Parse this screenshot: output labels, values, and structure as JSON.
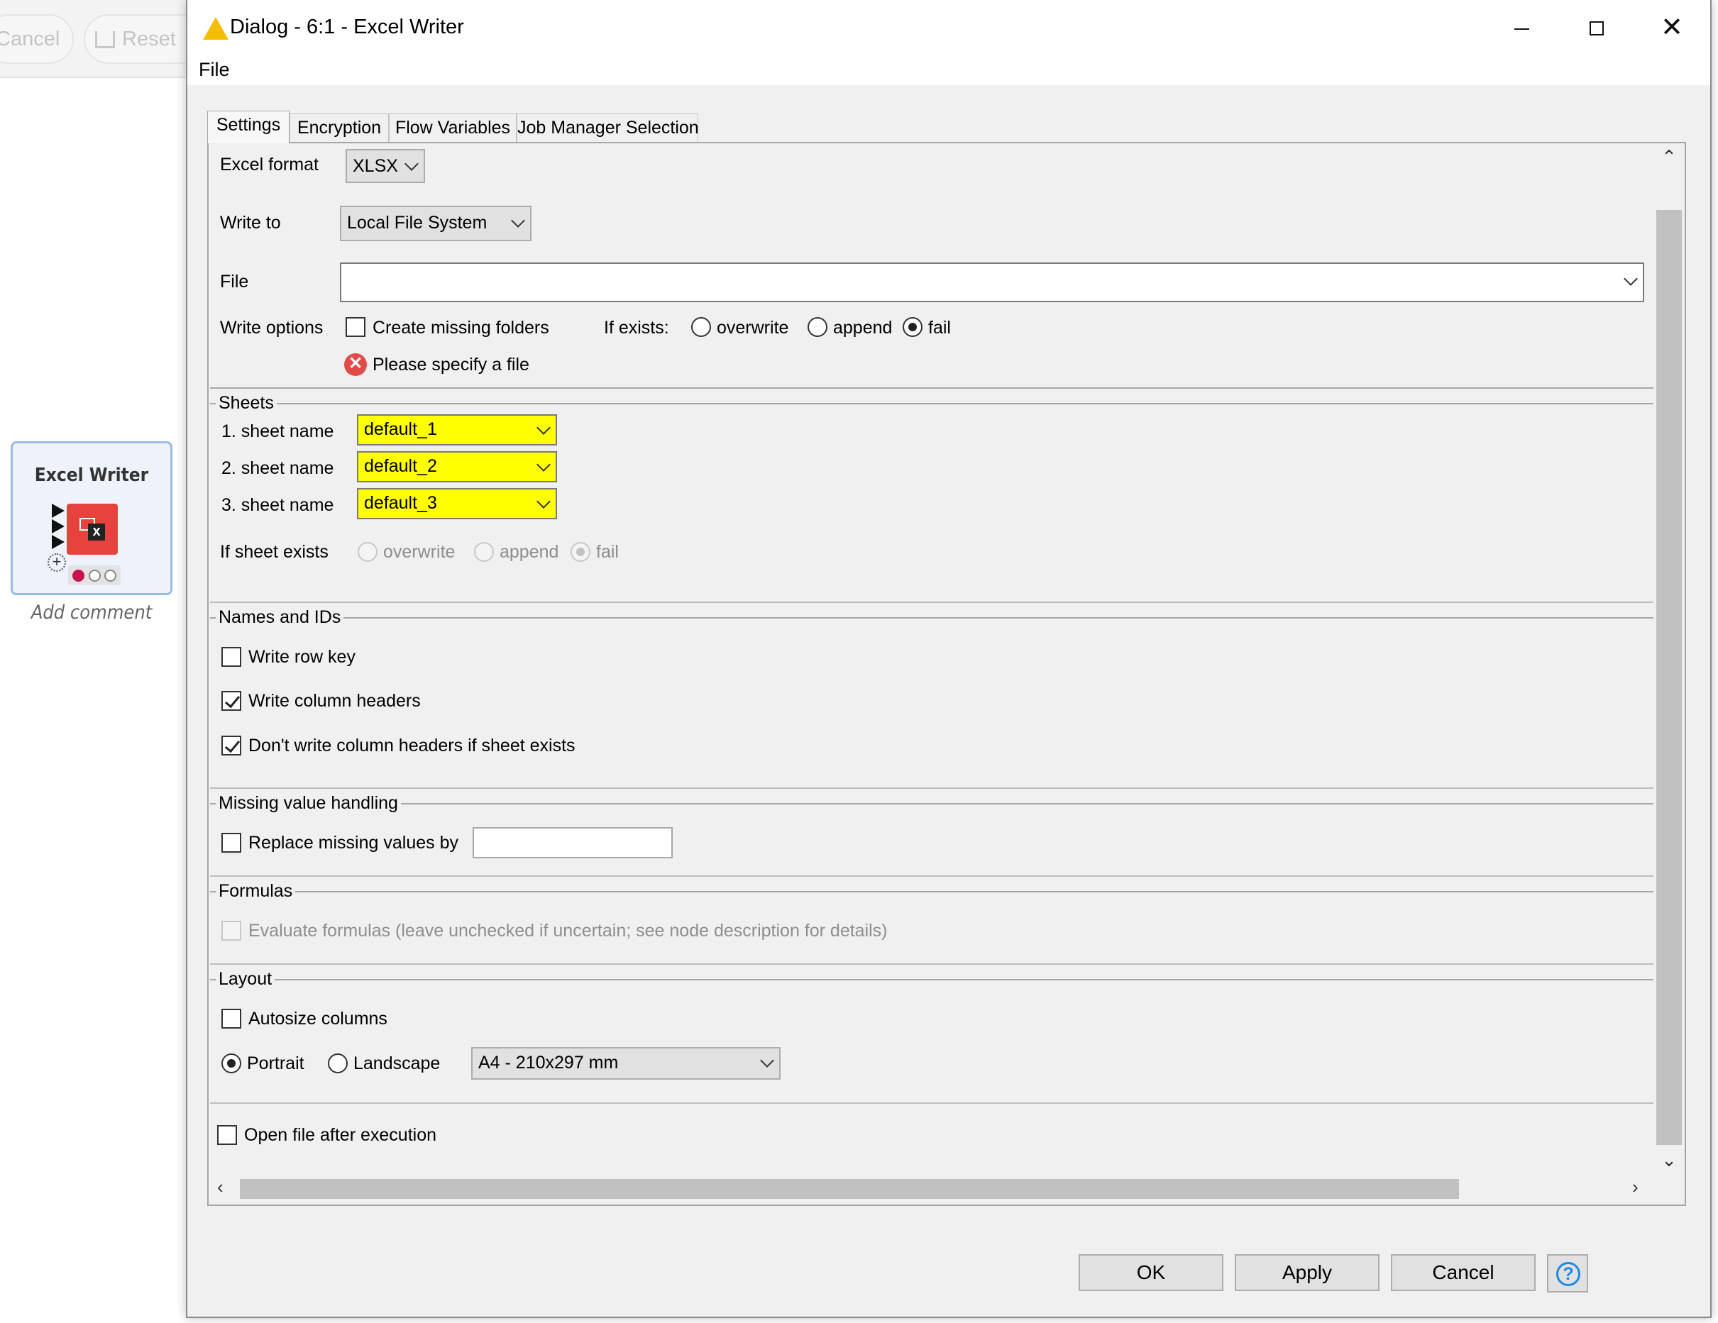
{
  "background": {
    "toolbar": {
      "cancel_label": "Cancel",
      "reset_label": "Reset"
    },
    "node": {
      "title": "Excel Writer",
      "add_comment": "Add comment"
    }
  },
  "dialog": {
    "title": "Dialog - 6:1 - Excel Writer",
    "menu": {
      "file": "File"
    },
    "tabs": [
      {
        "label": "Settings",
        "active": true
      },
      {
        "label": "Encryption"
      },
      {
        "label": "Flow Variables"
      },
      {
        "label": "Job Manager Selection"
      }
    ],
    "settings": {
      "excel_format": {
        "label": "Excel format",
        "value": "XLSX"
      },
      "write_to": {
        "label": "Write to",
        "value": "Local File System"
      },
      "file": {
        "label": "File",
        "value": ""
      },
      "write_options": {
        "label": "Write options",
        "create_missing_folders": {
          "label": "Create missing folders",
          "checked": false
        },
        "if_exists_label": "If exists:",
        "if_exists_options": [
          "overwrite",
          "append",
          "fail"
        ],
        "if_exists_selected": "fail",
        "error": "Please specify a file"
      },
      "sheets": {
        "title": "Sheets",
        "rows": [
          {
            "label": "1. sheet name",
            "value": "default_1"
          },
          {
            "label": "2. sheet name",
            "value": "default_2"
          },
          {
            "label": "3. sheet name",
            "value": "default_3"
          }
        ],
        "if_sheet_exists_label": "If sheet exists",
        "if_sheet_exists_options": [
          "overwrite",
          "append",
          "fail"
        ],
        "if_sheet_exists_selected": "fail"
      },
      "names_ids": {
        "title": "Names and IDs",
        "write_row_key": {
          "label": "Write row key",
          "checked": false
        },
        "write_column_headers": {
          "label": "Write column headers",
          "checked": true
        },
        "dont_write_headers": {
          "label": "Don't write column headers if sheet exists",
          "checked": true
        }
      },
      "missing_values": {
        "title": "Missing value handling",
        "replace": {
          "label": "Replace missing values by",
          "checked": false,
          "value": ""
        }
      },
      "formulas": {
        "title": "Formulas",
        "evaluate": {
          "label": "Evaluate formulas (leave unchecked if uncertain; see node description for details)",
          "checked": false,
          "enabled": false
        }
      },
      "layout": {
        "title": "Layout",
        "autosize": {
          "label": "Autosize columns",
          "checked": false
        },
        "orientation_options": [
          "Portrait",
          "Landscape"
        ],
        "orientation_selected": "Portrait",
        "paper_size": "A4 - 210x297 mm"
      },
      "open_after_execution": {
        "label": "Open file after execution",
        "checked": false
      }
    },
    "buttons": {
      "ok": "OK",
      "apply": "Apply",
      "cancel": "Cancel",
      "help": "?"
    }
  },
  "colors": {
    "required_field_highlight": "#ffff00",
    "error_red": "#e34b4b",
    "warning_yellow": "#f6be00",
    "help_blue": "#1e88e5",
    "node_red": "#e8423f",
    "node_status_red": "#c8134f"
  },
  "icons": {
    "title": "warning-triangle-icon",
    "error": "error-circle-icon",
    "help": "help-icon",
    "node": "excel-writer-node-icon"
  }
}
